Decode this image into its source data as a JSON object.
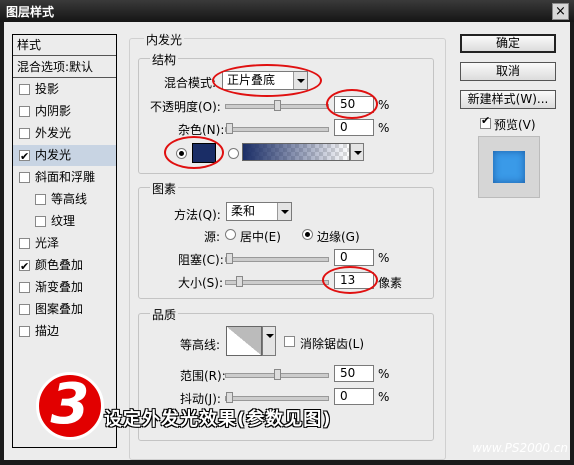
{
  "window": {
    "title": "图层样式",
    "close_glyph": "×"
  },
  "sidebar": {
    "header": "样式",
    "blend_default": "混合选项:默认",
    "items": [
      {
        "label": "投影",
        "checked": false
      },
      {
        "label": "内阴影",
        "checked": false
      },
      {
        "label": "外发光",
        "checked": false
      },
      {
        "label": "内发光",
        "checked": true
      },
      {
        "label": "斜面和浮雕",
        "checked": false
      },
      {
        "label": "等高线",
        "checked": false
      },
      {
        "label": "纹理",
        "checked": false
      },
      {
        "label": "光泽",
        "checked": false
      },
      {
        "label": "颜色叠加",
        "checked": true
      },
      {
        "label": "渐变叠加",
        "checked": false
      },
      {
        "label": "图案叠加",
        "checked": false
      },
      {
        "label": "描边",
        "checked": false
      }
    ]
  },
  "panel": {
    "title": "内发光",
    "structure": {
      "title": "结构",
      "blend_mode_label": "混合模式:",
      "blend_mode_value": "正片叠底",
      "opacity_label": "不透明度(O):",
      "opacity_value": "50",
      "opacity_unit": "%",
      "opacity_level": 50,
      "noise_label": "杂色(N):",
      "noise_value": "0",
      "noise_unit": "%",
      "noise_level": 0,
      "glow_color": "#1a2d66"
    },
    "elements": {
      "title": "图素",
      "method_label": "方法(Q):",
      "method_value": "柔和",
      "source_label": "源:",
      "source_center": "居中(E)",
      "source_edge": "边缘(G)",
      "choke_label": "阻塞(C):",
      "choke_value": "0",
      "choke_unit": "%",
      "choke_level": 0,
      "size_label": "大小(S):",
      "size_value": "13",
      "size_unit": "像素"
    },
    "quality": {
      "title": "品质",
      "contour_label": "等高线:",
      "antialias_label": "消除锯齿(L)",
      "range_label": "范围(R):",
      "range_value": "50",
      "range_unit": "%",
      "range_level": 50,
      "jitter_label": "抖动(J):",
      "jitter_value": "0",
      "jitter_unit": "%",
      "jitter_level": 0
    }
  },
  "buttons": {
    "ok": "确定",
    "cancel": "取消",
    "new_style": "新建样式(W)...",
    "preview_label": "预览(V)"
  },
  "overlay": {
    "step_number": "3",
    "caption": "设定外发光效果(参数见图)",
    "watermark": "www.PS2000.cn"
  },
  "colors": {
    "accent_red": "#e01010",
    "preview_swatch": "#3a9ae8"
  }
}
